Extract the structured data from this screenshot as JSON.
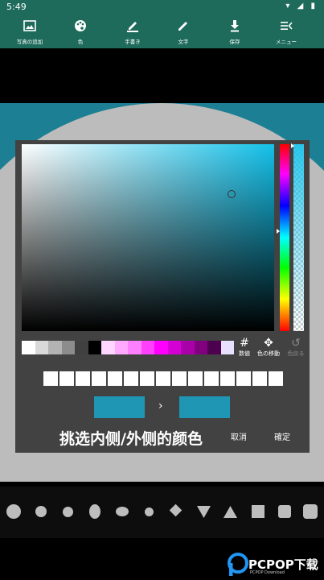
{
  "status_bar": {
    "time": "5:49",
    "icons": "▾ ◢ ▮"
  },
  "toolbar": {
    "items": [
      {
        "label": "写真の追加",
        "icon": "image-icon"
      },
      {
        "label": "色",
        "icon": "palette-icon"
      },
      {
        "label": "手書き",
        "icon": "pen-icon"
      },
      {
        "label": "文字",
        "icon": "text-pencil-icon"
      },
      {
        "label": "保存",
        "icon": "download-icon"
      },
      {
        "label": "メニュー",
        "icon": "menu-icon"
      }
    ]
  },
  "colors": {
    "toolbar_bg": "#1e6b5c",
    "canvas_bg": "#1c7f93",
    "circle": "#bcbcbc",
    "dialog_bg": "#424242",
    "picker_hue": "#14c1ea",
    "old_color": "#1e96b4",
    "new_color": "#1e96b4"
  },
  "color_dialog": {
    "palette": [
      "#ffffff",
      "#d9d9d9",
      "#b3b3b3",
      "#8c8c8c",
      "#404040",
      "#000000",
      "#ffd6ff",
      "#ffaaff",
      "#ff80ff",
      "#ff40ff",
      "#ff00ff",
      "#d400d4",
      "#aa00aa",
      "#800080",
      "#4d004d",
      "#e8e0ff"
    ],
    "hex_button": {
      "icon": "#",
      "label": "数値"
    },
    "move_button": {
      "icon": "✥",
      "label": "色の移動"
    },
    "undo_button": {
      "icon": "↺",
      "label": "色戻る"
    },
    "history_count": 15,
    "arrow": "›",
    "cancel_label": "取消",
    "ok_label": "確定"
  },
  "caption": "挑选内侧/外侧的颜色",
  "shapes": [
    "circle-large",
    "circle-medium",
    "circle-small",
    "ellipse-vertical",
    "ellipse-horizontal",
    "circle-tiny",
    "diamond",
    "triangle-down",
    "triangle-up",
    "square",
    "rounded-square",
    "rounded-square-large"
  ],
  "watermark": {
    "text": "PCPOP下载",
    "sub": "PCPOP Download"
  }
}
